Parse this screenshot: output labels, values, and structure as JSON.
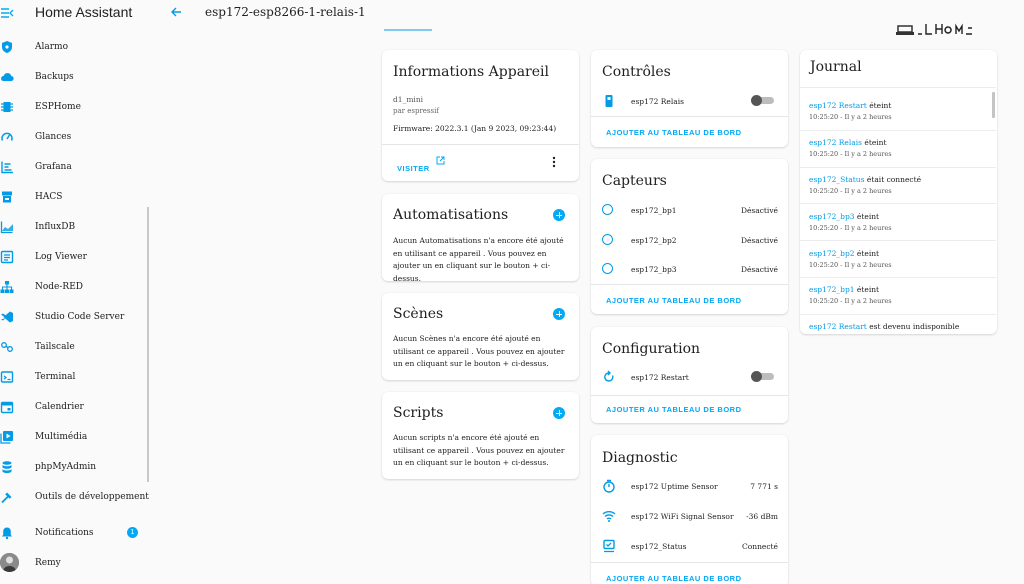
{
  "app": {
    "title": "Home Assistant"
  },
  "page": {
    "title": "esp172-esp8266-1-relais-1"
  },
  "sidebar": {
    "items": [
      {
        "label": "Alarmo",
        "icon": "shield-icon"
      },
      {
        "label": "Backups",
        "icon": "cloud-icon"
      },
      {
        "label": "ESPHome",
        "icon": "chip-icon"
      },
      {
        "label": "Glances",
        "icon": "gauge-icon"
      },
      {
        "label": "Grafana",
        "icon": "chart-icon"
      },
      {
        "label": "HACS",
        "icon": "store-icon"
      },
      {
        "label": "InfluxDB",
        "icon": "area-chart-icon"
      },
      {
        "label": "Log Viewer",
        "icon": "text-box-icon"
      },
      {
        "label": "Node-RED",
        "icon": "sitemap-icon"
      },
      {
        "label": "Studio Code Server",
        "icon": "vscode-icon"
      },
      {
        "label": "Tailscale",
        "icon": "tailscale-icon"
      },
      {
        "label": "Terminal",
        "icon": "console-icon"
      },
      {
        "label": "Calendrier",
        "icon": "calendar-icon"
      },
      {
        "label": "Multimédia",
        "icon": "play-box-icon"
      },
      {
        "label": "phpMyAdmin",
        "icon": "database-icon"
      },
      {
        "label": "Outils de développement",
        "icon": "hammer-icon"
      }
    ],
    "notifications": {
      "label": "Notifications",
      "count": "1"
    },
    "user": {
      "name": "Remy"
    }
  },
  "colors": {
    "accent": "#03a9f4",
    "link": "#039be5",
    "background": "#fafafa",
    "card": "#ffffff"
  },
  "device_info": {
    "title": "Informations Appareil",
    "model": "d1_mini",
    "manufacturer": "par espressif",
    "firmware": "Firmware: 2022.3.1 (Jan 9 2023, 09:23:44)",
    "visit_label": "VISITER"
  },
  "automations": {
    "title": "Automatisations",
    "empty": "Aucun Automatisations n'a encore été ajouté en utilisant ce appareil . Vous pouvez en ajouter un en cliquant sur le bouton + ci-dessus."
  },
  "scenes": {
    "title": "Scènes",
    "empty": "Aucun Scènes n'a encore été ajouté en utilisant ce appareil . Vous pouvez en ajouter un en cliquant sur le bouton + ci-dessus."
  },
  "scripts": {
    "title": "Scripts",
    "empty": "Aucun scripts n'a encore été ajouté en utilisant ce appareil . Vous pouvez en ajouter un en cliquant sur le bouton + ci-dessus."
  },
  "controls": {
    "title": "Contrôles",
    "rows": [
      {
        "label": "esp172 Relais",
        "state": "off"
      }
    ],
    "action": "AJOUTER AU TABLEAU DE BORD"
  },
  "sensors": {
    "title": "Capteurs",
    "rows": [
      {
        "label": "esp172_bp1",
        "value": "Désactivé"
      },
      {
        "label": "esp172_bp2",
        "value": "Désactivé"
      },
      {
        "label": "esp172_bp3",
        "value": "Désactivé"
      }
    ],
    "action": "AJOUTER AU TABLEAU DE BORD"
  },
  "configuration": {
    "title": "Configuration",
    "rows": [
      {
        "label": "esp172 Restart",
        "state": "off"
      }
    ],
    "action": "AJOUTER AU TABLEAU DE BORD"
  },
  "diagnostic": {
    "title": "Diagnostic",
    "rows": [
      {
        "label": "esp172 Uptime Sensor",
        "value": "7 771 s",
        "icon": "timer-icon"
      },
      {
        "label": "esp172 WiFi Signal Sensor",
        "value": "-36 dBm",
        "icon": "wifi-icon"
      },
      {
        "label": "esp172_Status",
        "value": "Connecté",
        "icon": "monitor-icon"
      }
    ],
    "action": "AJOUTER AU TABLEAU DE BORD"
  },
  "journal": {
    "title": "Journal",
    "entries": [
      {
        "entity": "esp172 Restart",
        "text": "éteint",
        "time": "10:25:20 - Il y a 2 heures"
      },
      {
        "entity": "esp172 Relais",
        "text": "éteint",
        "time": "10:25:20 - Il y a 2 heures"
      },
      {
        "entity": "esp172_Status",
        "text": "était connecté",
        "time": "10:25:20 - Il y a 2 heures"
      },
      {
        "entity": "esp172_bp3",
        "text": "éteint",
        "time": "10:25:20 - Il y a 2 heures"
      },
      {
        "entity": "esp172_bp2",
        "text": "éteint",
        "time": "10:25:20 - Il y a 2 heures"
      },
      {
        "entity": "esp172_bp1",
        "text": "éteint",
        "time": "10:25:20 - Il y a 2 heures"
      },
      {
        "entity": "esp172 Restart",
        "text": "est devenu indisponible",
        "time": ""
      }
    ]
  }
}
